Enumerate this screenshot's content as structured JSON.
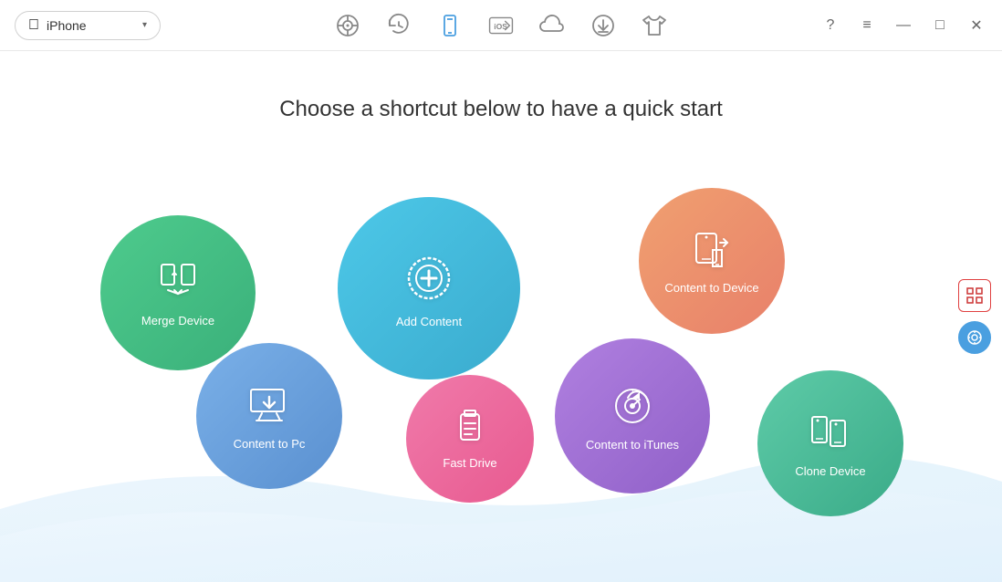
{
  "titleBar": {
    "deviceName": "iPhone",
    "deviceIcon": "apple",
    "dropdownLabel": "iPhone",
    "toolbarItems": [
      {
        "id": "music",
        "label": "Music",
        "active": false
      },
      {
        "id": "history",
        "label": "History",
        "active": false
      },
      {
        "id": "device",
        "label": "Device",
        "active": true
      },
      {
        "id": "ios",
        "label": "iOS",
        "active": false
      },
      {
        "id": "cloud",
        "label": "Cloud",
        "active": false
      },
      {
        "id": "download",
        "label": "Download",
        "active": false
      },
      {
        "id": "tshirt",
        "label": "Shop",
        "active": false
      }
    ],
    "windowControls": {
      "help": "?",
      "menu": "≡",
      "minimize": "—",
      "maximize": "□",
      "close": "✕"
    }
  },
  "mainContent": {
    "pageTitle": "Choose a shortcut below to have a quick start",
    "circles": [
      {
        "id": "merge",
        "label": "Merge Device",
        "cssClass": "circle-merge"
      },
      {
        "id": "add",
        "label": "Add Content",
        "cssClass": "circle-add"
      },
      {
        "id": "content-device",
        "label": "Content to Device",
        "cssClass": "circle-content-device"
      },
      {
        "id": "pc",
        "label": "Content to Pc",
        "cssClass": "circle-pc"
      },
      {
        "id": "fast",
        "label": "Fast Drive",
        "cssClass": "circle-fast"
      },
      {
        "id": "itunes",
        "label": "Content to iTunes",
        "cssClass": "circle-itunes"
      },
      {
        "id": "clone",
        "label": "Clone Device",
        "cssClass": "circle-clone"
      }
    ]
  },
  "rightSidebar": {
    "gridBtn": "grid",
    "toolBtn": "tool"
  }
}
